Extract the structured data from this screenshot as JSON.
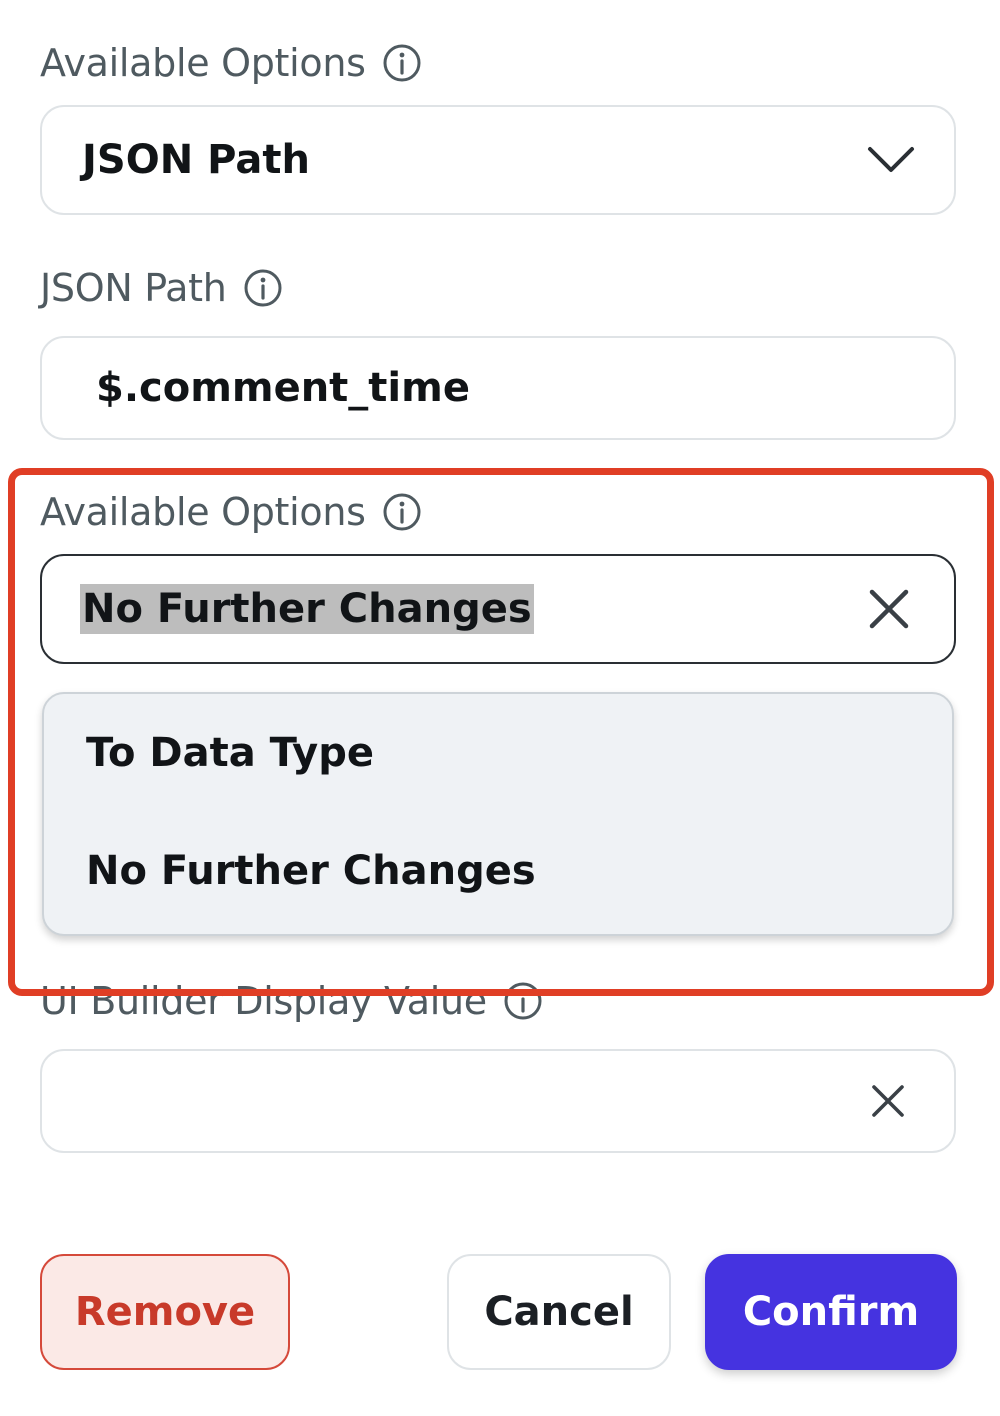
{
  "section1": {
    "label": "Available Options",
    "info_icon": "info-icon",
    "select_value": "JSON Path",
    "chevron_icon": "chevron-down-icon"
  },
  "section2": {
    "label": "JSON Path",
    "info_icon": "info-icon",
    "input_value": "$.comment_time"
  },
  "section3": {
    "label": "Available Options",
    "info_icon": "info-icon",
    "input_value": "No Further Changes",
    "clear_icon": "close-icon",
    "dropdown_options": [
      "To Data Type",
      "No Further Changes"
    ]
  },
  "section4": {
    "label": "UI Builder Display Value",
    "info_icon": "info-icon",
    "input_value": "",
    "clear_icon": "close-icon"
  },
  "footer": {
    "remove_label": "Remove",
    "cancel_label": "Cancel",
    "confirm_label": "Confirm"
  },
  "colors": {
    "highlight": "#e03e25",
    "confirm_bg": "#4533e0",
    "remove_bg": "#fbe9e6",
    "remove_text": "#c83a2a",
    "dropdown_bg": "#eff2f5",
    "selection_bg": "#bdbdbd"
  }
}
